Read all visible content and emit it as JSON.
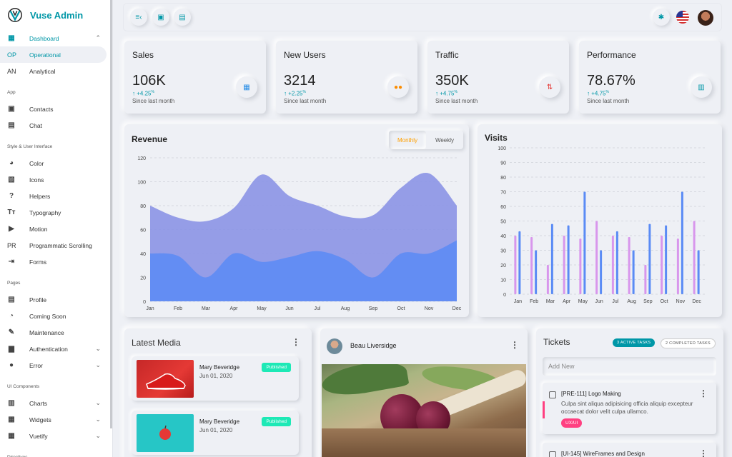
{
  "brand": {
    "title": "Vuse Admin"
  },
  "sidebar": {
    "top": [
      {
        "icon": "dashboard-icon",
        "label": "Dashboard",
        "active": true,
        "chev": "^"
      },
      {
        "abbr": "OP",
        "label": "Operational",
        "selected": true
      },
      {
        "abbr": "AN",
        "label": "Analytical"
      }
    ],
    "sections": [
      {
        "title": "App",
        "items": [
          {
            "icon": "contacts-icon",
            "glyph": "▣",
            "label": "Contacts"
          },
          {
            "icon": "chat-icon",
            "glyph": "▤",
            "label": "Chat"
          }
        ]
      },
      {
        "title": "Style & User Interface",
        "items": [
          {
            "icon": "palette-icon",
            "glyph": "◕",
            "label": "Color"
          },
          {
            "icon": "icons-icon",
            "glyph": "▧",
            "label": "Icons"
          },
          {
            "icon": "help-icon",
            "glyph": "?",
            "label": "Helpers"
          },
          {
            "icon": "typography-icon",
            "glyph": "Tт",
            "label": "Typography"
          },
          {
            "icon": "motion-icon",
            "glyph": "▶",
            "label": "Motion"
          },
          {
            "abbr": "PR",
            "label": "Programmatic Scrolling"
          },
          {
            "icon": "forms-icon",
            "glyph": "⇥",
            "label": "Forms"
          }
        ]
      },
      {
        "title": "Pages",
        "items": [
          {
            "icon": "profile-icon",
            "glyph": "▤",
            "label": "Profile"
          },
          {
            "icon": "timer-icon",
            "glyph": "◔",
            "label": "Coming Soon"
          },
          {
            "icon": "wrench-icon",
            "glyph": "✎",
            "label": "Maintenance"
          },
          {
            "icon": "lock-icon",
            "glyph": "▆",
            "label": "Authentication",
            "chev": "v"
          },
          {
            "icon": "error-icon",
            "glyph": "●",
            "label": "Error",
            "chev": "v"
          }
        ]
      },
      {
        "title": "UI Components",
        "items": [
          {
            "icon": "charts-icon",
            "glyph": "▥",
            "label": "Charts",
            "chev": "v"
          },
          {
            "icon": "widgets-icon",
            "glyph": "▦",
            "label": "Widgets",
            "chev": "v"
          },
          {
            "icon": "vuetify-icon",
            "glyph": "▦",
            "label": "Vuetify",
            "chev": "v"
          }
        ]
      },
      {
        "title": "Directives",
        "items": []
      }
    ]
  },
  "stats": [
    {
      "label": "Sales",
      "value": "106K",
      "delta": "+4.25",
      "pct": "%",
      "since": "Since last month",
      "icon": "store-icon",
      "color": "#1e88e5"
    },
    {
      "label": "New Users",
      "value": "3214",
      "delta": "+2.25",
      "pct": "%",
      "since": "Since last month",
      "icon": "users-icon",
      "color": "#fb8c00"
    },
    {
      "label": "Traffic",
      "value": "350K",
      "delta": "+4.75",
      "pct": "%",
      "since": "Since last month",
      "icon": "traffic-icon",
      "color": "#e53935"
    },
    {
      "label": "Performance",
      "value": "78.67%",
      "delta": "+4.75",
      "pct": "%",
      "since": "Since last month",
      "icon": "performance-icon",
      "color": "#0097a7"
    }
  ],
  "revenue": {
    "title": "Revenue",
    "toggle": {
      "monthly": "Monthly",
      "weekly": "Weekly"
    }
  },
  "visits": {
    "title": "Visits"
  },
  "chart_data": [
    {
      "type": "area",
      "title": "Revenue",
      "categories": [
        "Jan",
        "Feb",
        "Mar",
        "Apr",
        "May",
        "Jun",
        "Jul",
        "Aug",
        "Sep",
        "Oct",
        "Nov",
        "Dec"
      ],
      "yticks": [
        0,
        20,
        40,
        60,
        80,
        100,
        120
      ],
      "ylim": [
        0,
        120
      ],
      "series": [
        {
          "values": [
            80,
            70,
            67,
            78,
            106,
            88,
            80,
            71,
            72,
            95,
            107,
            80
          ],
          "color": "#8b93e6"
        },
        {
          "values": [
            40,
            38,
            20,
            40,
            33,
            37,
            42,
            35,
            20,
            40,
            40,
            51
          ],
          "color": "#5a8bf5"
        }
      ]
    },
    {
      "type": "bar",
      "title": "Visits",
      "categories": [
        "Jan",
        "Feb",
        "Mar",
        "Apr",
        "May",
        "Jun",
        "Jul",
        "Aug",
        "Sep",
        "Oct",
        "Nov",
        "Dec"
      ],
      "yticks": [
        0,
        10,
        20,
        30,
        40,
        50,
        60,
        70,
        80,
        90,
        100
      ],
      "ylim": [
        0,
        100
      ],
      "series": [
        {
          "values": [
            40,
            39,
            20,
            40,
            38,
            50,
            40,
            39,
            20,
            40,
            38,
            50
          ],
          "color": "#d896ec"
        },
        {
          "values": [
            43,
            30,
            48,
            47,
            70,
            30,
            43,
            30,
            48,
            47,
            70,
            30
          ],
          "color": "#5a8bf5"
        }
      ]
    }
  ],
  "media": {
    "title": "Latest Media",
    "items": [
      {
        "name": "Mary Beveridge",
        "date": "Jun 01, 2020",
        "status": "Published"
      },
      {
        "name": "Mary Beveridge",
        "date": "Jun 01, 2020",
        "status": "Published"
      }
    ]
  },
  "post": {
    "author": "Beau Liversidge"
  },
  "tickets": {
    "title": "Tickets",
    "active": "3 ACTIVE TASKS",
    "completed": "2 COMPLETED TASKS",
    "add_placeholder": "Add New",
    "items": [
      {
        "title": "[PRE-111] Logo Making",
        "desc": "Culpa sint aliqua adipisicing officia aliquip excepteur occaecat dolor velit culpa ullamco.",
        "tag": "UX/UI"
      },
      {
        "title": "[UI-145] WireFrames and Design"
      }
    ]
  }
}
